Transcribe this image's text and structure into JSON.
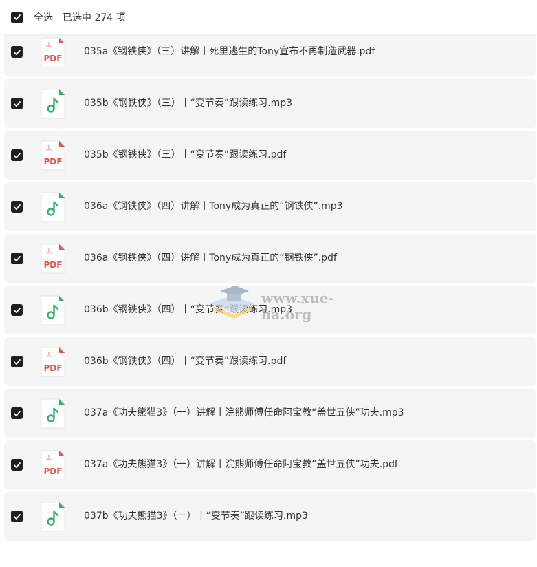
{
  "header": {
    "select_all_label": "全选",
    "selected_label": "已选中 274 项"
  },
  "watermark": {
    "text": "www.xue-ba.org"
  },
  "colors": {
    "pdf_red": "#e8534a",
    "audio_green": "#2fb36a",
    "checkbox": "#1f1f1f",
    "row_bg": "#f5f5f6"
  },
  "files": [
    {
      "name": "",
      "type": "audio",
      "checked": true
    },
    {
      "name": "035a《钢铁侠》（三）讲解丨死里逃生的Tony宣布不再制造武器.pdf",
      "type": "pdf",
      "checked": true
    },
    {
      "name": "035b《钢铁侠》（三）丨“变节奏”跟读练习.mp3",
      "type": "audio",
      "checked": true
    },
    {
      "name": "035b《钢铁侠》（三）丨“变节奏”跟读练习.pdf",
      "type": "pdf",
      "checked": true
    },
    {
      "name": "036a《钢铁侠》（四）讲解丨Tony成为真正的“钢铁侠”.mp3",
      "type": "audio",
      "checked": true
    },
    {
      "name": "036a《钢铁侠》（四）讲解丨Tony成为真正的“钢铁侠”.pdf",
      "type": "pdf",
      "checked": true
    },
    {
      "name": "036b《钢铁侠》（四）丨“变节奏”跟读练习.mp3",
      "type": "audio",
      "checked": true
    },
    {
      "name": "036b《钢铁侠》（四）丨“变节奏”跟读练习.pdf",
      "type": "pdf",
      "checked": true
    },
    {
      "name": "037a《功夫熊猫3》（一）讲解丨浣熊师傅任命阿宝教“盖世五侠”功夫.mp3",
      "type": "audio",
      "checked": true
    },
    {
      "name": "037a《功夫熊猫3》（一）讲解丨浣熊师傅任命阿宝教“盖世五侠”功夫.pdf",
      "type": "pdf",
      "checked": true
    },
    {
      "name": "037b《功夫熊猫3》（一）丨“变节奏”跟读练习.mp3",
      "type": "audio",
      "checked": true
    }
  ]
}
